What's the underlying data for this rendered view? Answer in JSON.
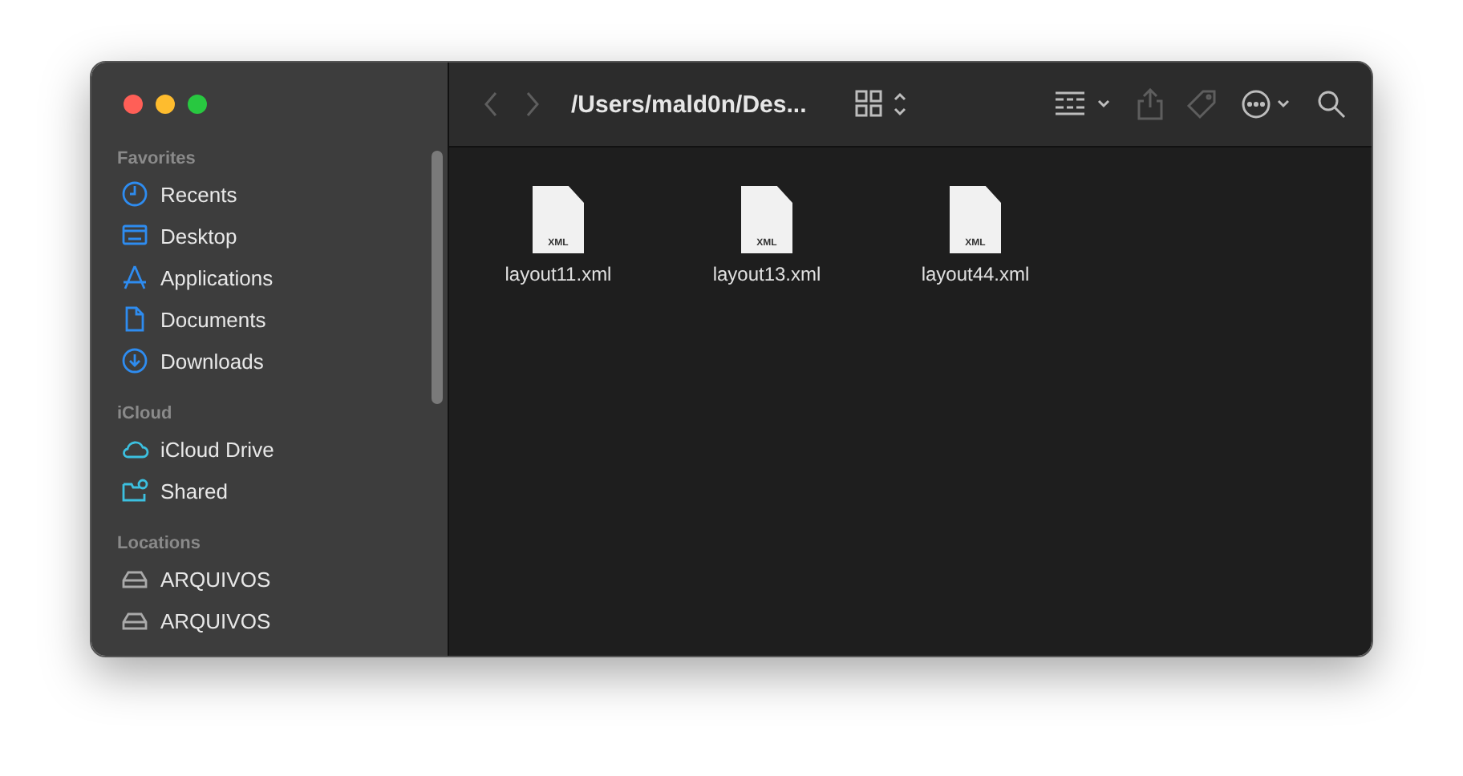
{
  "window": {
    "path": "/Users/mald0n/Des..."
  },
  "sidebar": {
    "sections": [
      {
        "title": "Favorites",
        "items": [
          {
            "label": "Recents",
            "kind": "clock",
            "selected": false
          },
          {
            "label": "Desktop",
            "kind": "desktop",
            "selected": false
          },
          {
            "label": "Applications",
            "kind": "apps",
            "selected": false
          },
          {
            "label": "Documents",
            "kind": "document",
            "selected": false
          },
          {
            "label": "Downloads",
            "kind": "download",
            "selected": false
          }
        ]
      },
      {
        "title": "iCloud",
        "items": [
          {
            "label": "iCloud Drive",
            "kind": "cloud",
            "selected": false
          },
          {
            "label": "Shared",
            "kind": "shared",
            "selected": false
          }
        ]
      },
      {
        "title": "Locations",
        "items": [
          {
            "label": "ARQUIVOS",
            "kind": "drive",
            "selected": false
          },
          {
            "label": "ARQUIVOS",
            "kind": "drive",
            "selected": false
          }
        ]
      }
    ]
  },
  "files": [
    {
      "name": "layout11.xml",
      "badge": "XML",
      "selected": false
    },
    {
      "name": "layout13.xml",
      "badge": "XML",
      "selected": false
    },
    {
      "name": "layout44.xml",
      "badge": "XML",
      "selected": false
    }
  ]
}
